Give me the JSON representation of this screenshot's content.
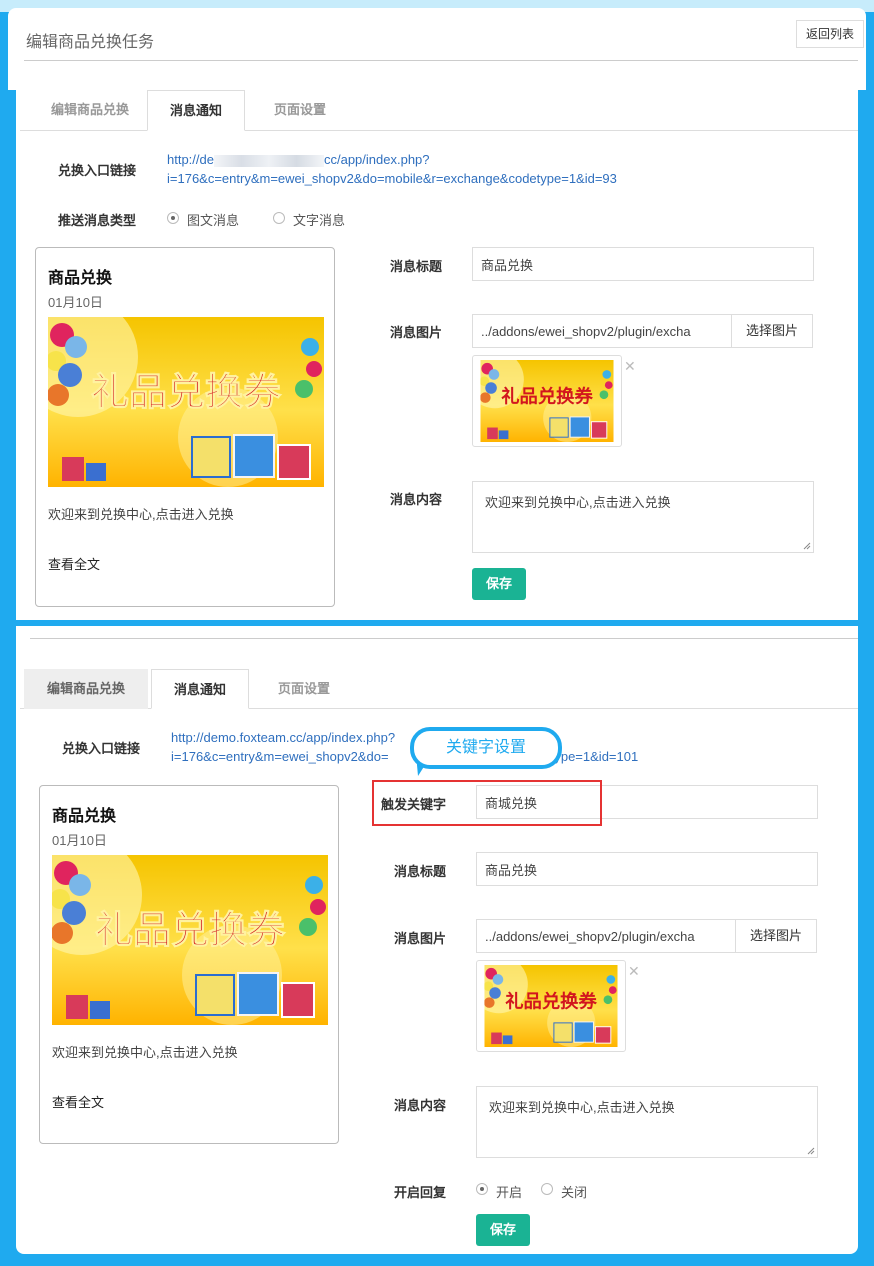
{
  "header": {
    "title": "编辑商品兑换任务",
    "back_label": "返回列表"
  },
  "images": {
    "banner_text": "礼品兑换券"
  },
  "section1": {
    "tabs": [
      "编辑商品兑换",
      "消息通知",
      "页面设置"
    ],
    "entry_label": "兑换入口链接",
    "entry_link_line1_pre": "http://de",
    "entry_link_line1_post": "cc/app/index.php?",
    "entry_link_line2": "i=176&c=entry&m=ewei_shopv2&do=mobile&r=exchange&codetype=1&id=93",
    "push_type_label": "推送消息类型",
    "push_options": [
      "图文消息",
      "文字消息"
    ],
    "card": {
      "title": "商品兑换",
      "date": "01月10日",
      "desc": "欢迎来到兑换中心,点击进入兑换",
      "more": "查看全文"
    },
    "form": {
      "title_label": "消息标题",
      "title_value": "商品兑换",
      "image_label": "消息图片",
      "image_value": "../addons/ewei_shopv2/plugin/excha",
      "choose_label": "选择图片",
      "content_label": "消息内容",
      "content_value": "欢迎来到兑换中心,点击进入兑换",
      "save_label": "保存"
    }
  },
  "section2": {
    "tabs": [
      "编辑商品兑换",
      "消息通知",
      "页面设置"
    ],
    "entry_label": "兑换入口链接",
    "entry_link_line1": "http://demo.foxteam.cc/app/index.php",
    "entry_link_line1_tail": "?",
    "entry_link_line2_pre": "i=176&c=entry&m=ewei_shopv2&do=",
    "entry_link_line2_post": "codetype=1&id=101",
    "callout": "关键字设置",
    "card": {
      "title": "商品兑换",
      "date": "01月10日",
      "desc": "欢迎来到兑换中心,点击进入兑换",
      "more": "查看全文"
    },
    "form": {
      "keyword_label": "触发关键字",
      "keyword_value": "商城兑换",
      "title_label": "消息标题",
      "title_value": "商品兑换",
      "image_label": "消息图片",
      "image_value": "../addons/ewei_shopv2/plugin/excha",
      "choose_label": "选择图片",
      "content_label": "消息内容",
      "content_value": "欢迎来到兑换中心,点击进入兑换",
      "reply_label": "开启回复",
      "reply_options": [
        "开启",
        "关闭"
      ],
      "save_label": "保存"
    }
  },
  "colors": {
    "accent": "#1faaef",
    "save": "#1ab394",
    "link": "#2f6fbe",
    "highlight": "#e53333"
  }
}
